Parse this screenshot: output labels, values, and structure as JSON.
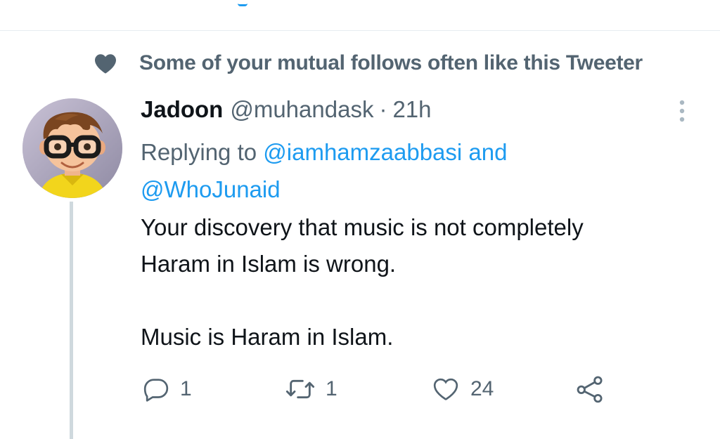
{
  "social_context": {
    "icon": "heart-icon",
    "text": "Some of your mutual follows often like this Tweeter"
  },
  "tweet": {
    "author": {
      "display_name": "Jadoon",
      "handle": "@muhandask",
      "avatar_icon": "memoji-avatar"
    },
    "separator": "·",
    "timestamp": "21h",
    "reply_context": {
      "prefix": "Replying to",
      "mention_1": "@iamhamzaabbasi",
      "conjunction": "and",
      "mention_2": "@WhoJunaid"
    },
    "text_lines": [
      "Your discovery that music is not completely",
      "Haram in Islam is wrong.",
      "Music is Haram in Islam."
    ],
    "actions": {
      "reply": {
        "icon": "reply-icon",
        "count": "1"
      },
      "retweet": {
        "icon": "retweet-icon",
        "count": "1"
      },
      "like": {
        "icon": "like-icon",
        "count": "24"
      },
      "share": {
        "icon": "share-icon"
      }
    }
  },
  "colors": {
    "accent": "#1d9bf0",
    "secondary_text": "#536471",
    "primary_text": "#0f1419",
    "thread_line": "#cfd9de"
  }
}
